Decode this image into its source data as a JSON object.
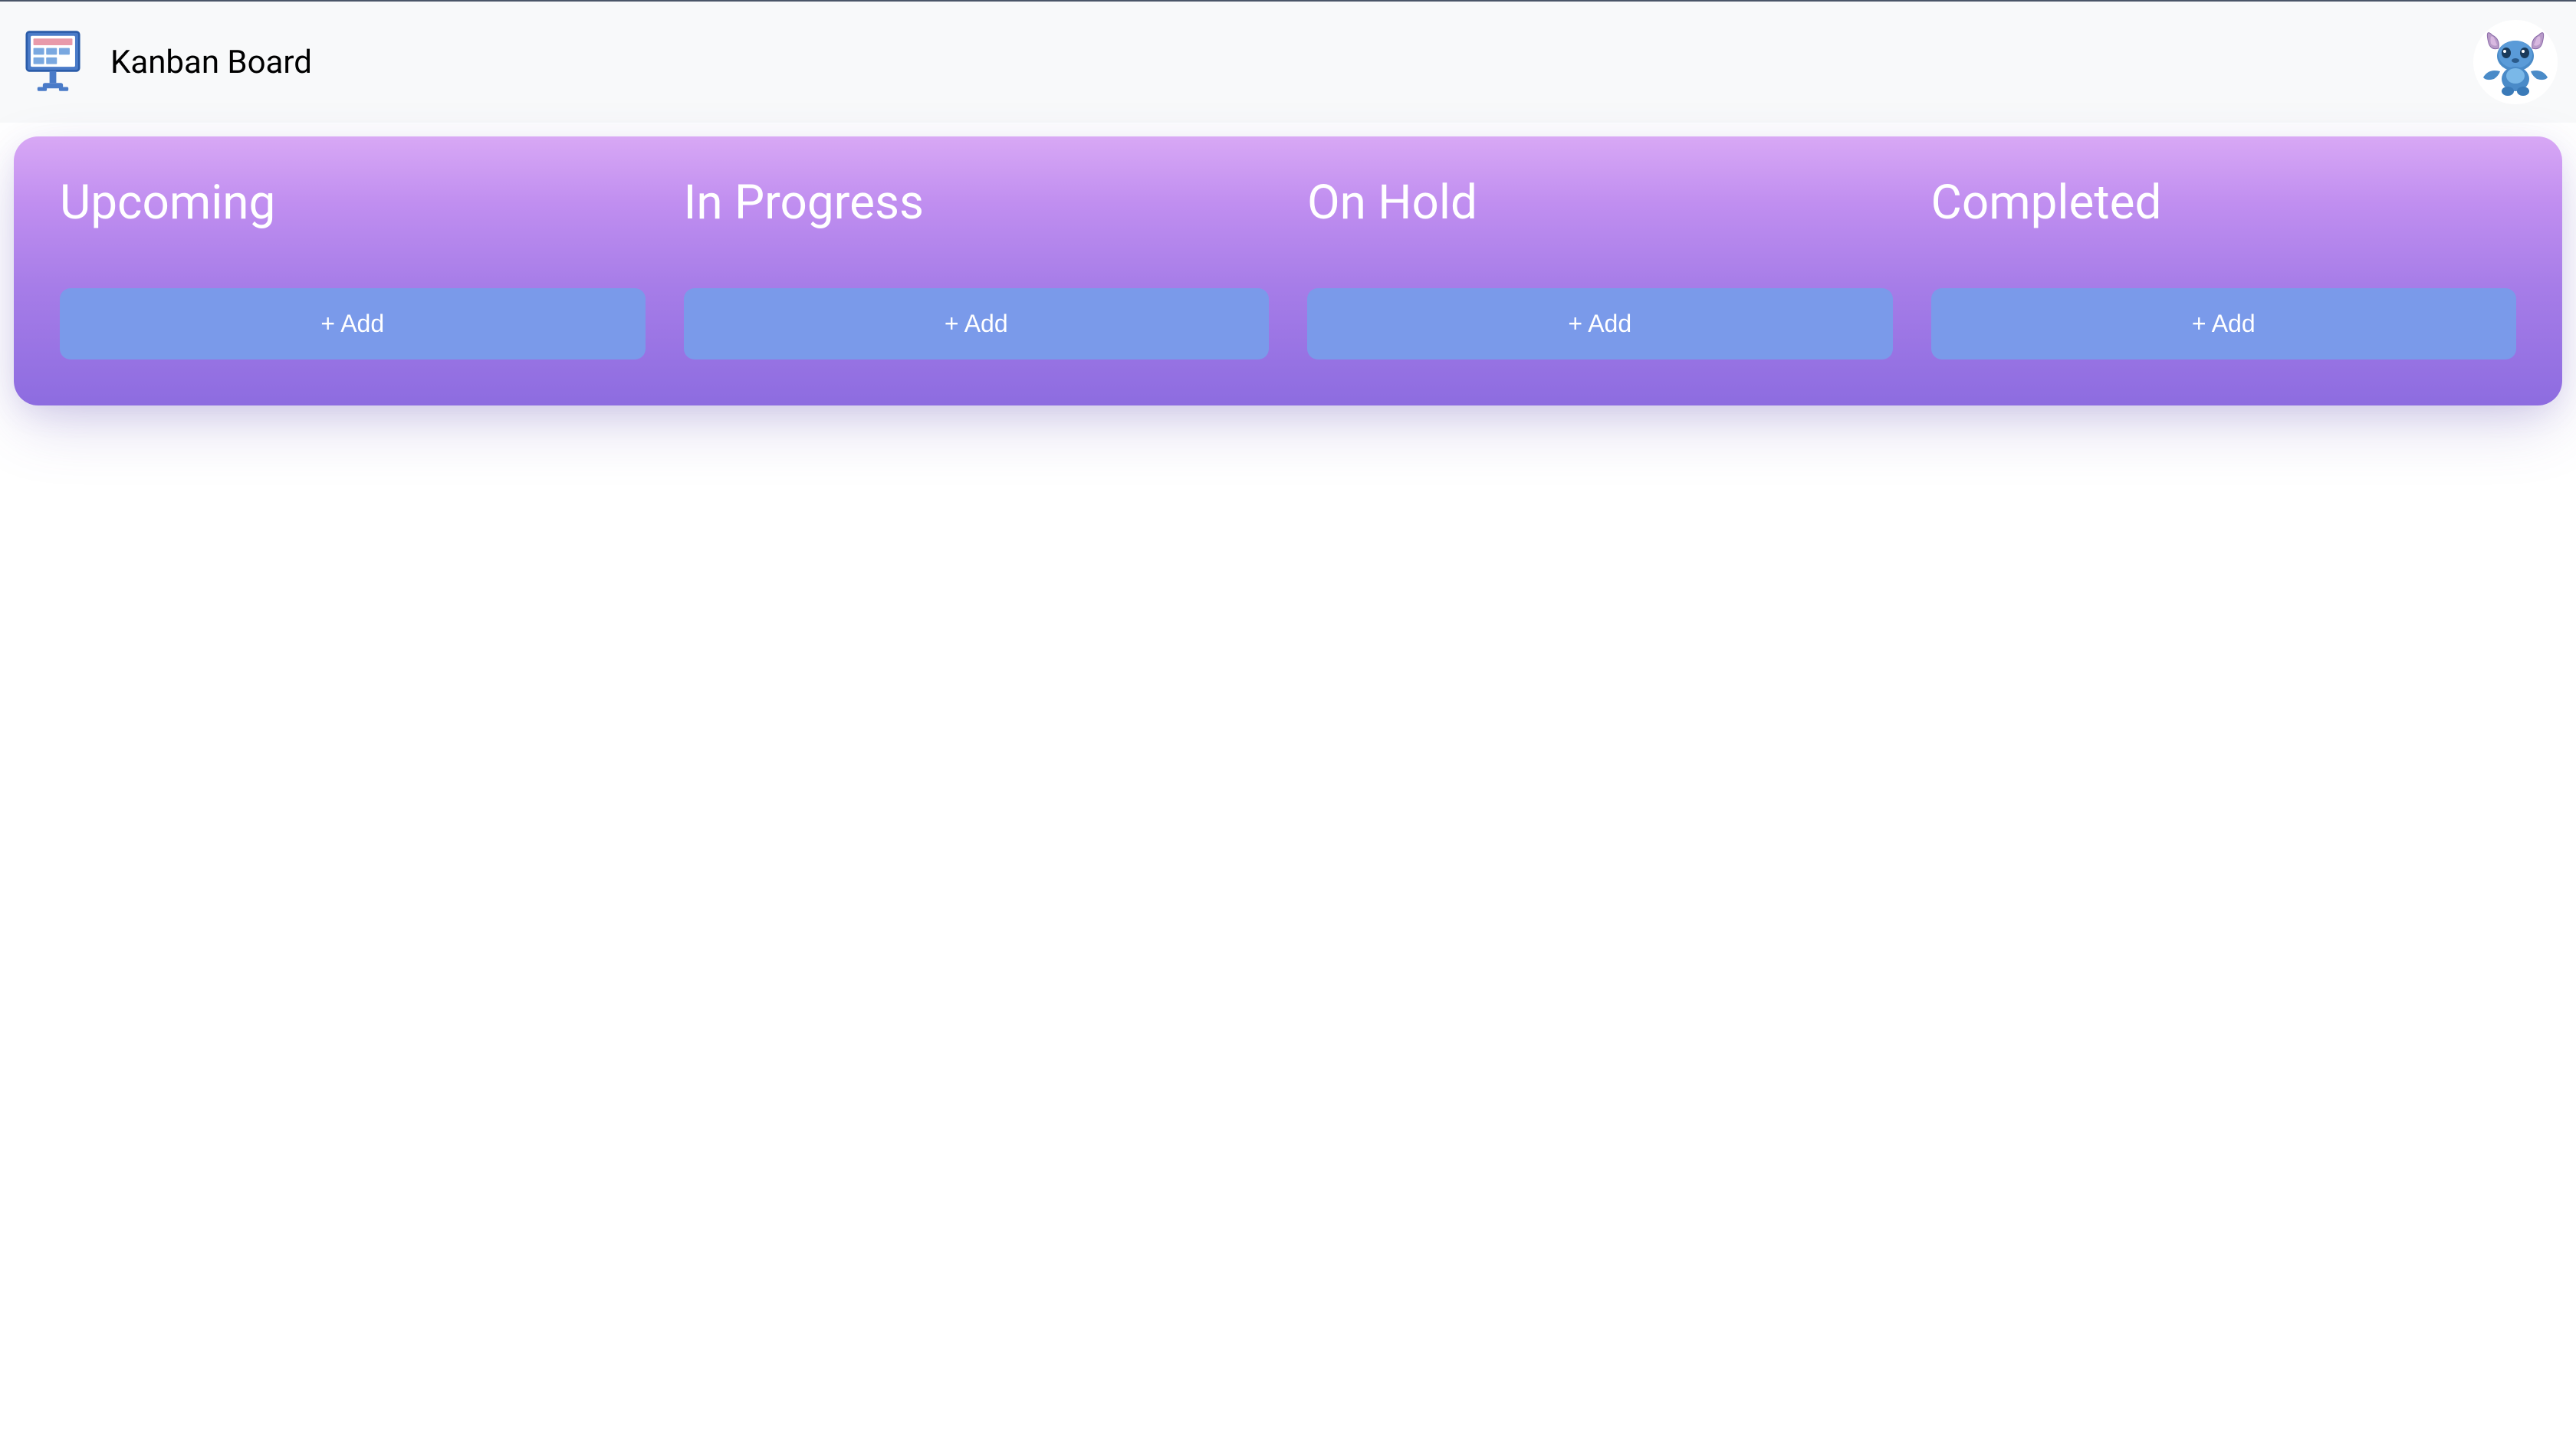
{
  "header": {
    "title": "Kanban Board"
  },
  "board": {
    "columns": [
      {
        "title": "Upcoming",
        "add_label": "+ Add"
      },
      {
        "title": "In Progress",
        "add_label": "+ Add"
      },
      {
        "title": "On Hold",
        "add_label": "+ Add"
      },
      {
        "title": "Completed",
        "add_label": "+ Add"
      }
    ]
  }
}
